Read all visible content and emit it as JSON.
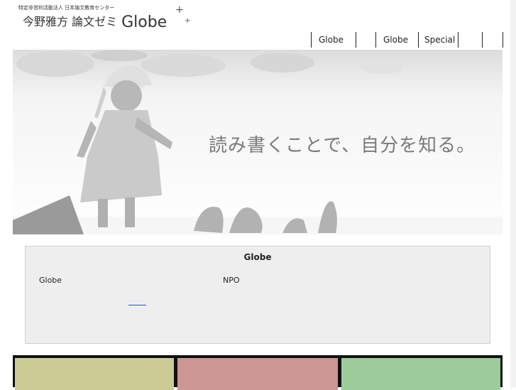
{
  "header": {
    "org_line": "特定非営利活動法人 日本論文教育センター",
    "title_jp": "今野雅方 論文ゼミ",
    "title_brand": "Globe"
  },
  "nav": {
    "items": [
      {
        "label": "Globe"
      },
      {
        "label": ""
      },
      {
        "label": "Globe"
      },
      {
        "label": "Special"
      },
      {
        "label": ""
      },
      {
        "label": ""
      }
    ]
  },
  "hero": {
    "tagline": "読み書くことで、自分を知る。"
  },
  "info": {
    "title": "Globe",
    "left_text": "Globe",
    "right_text": "NPO"
  },
  "tiles": {
    "colors": [
      "#cdcb95",
      "#cc9692",
      "#9bcc9a"
    ]
  }
}
